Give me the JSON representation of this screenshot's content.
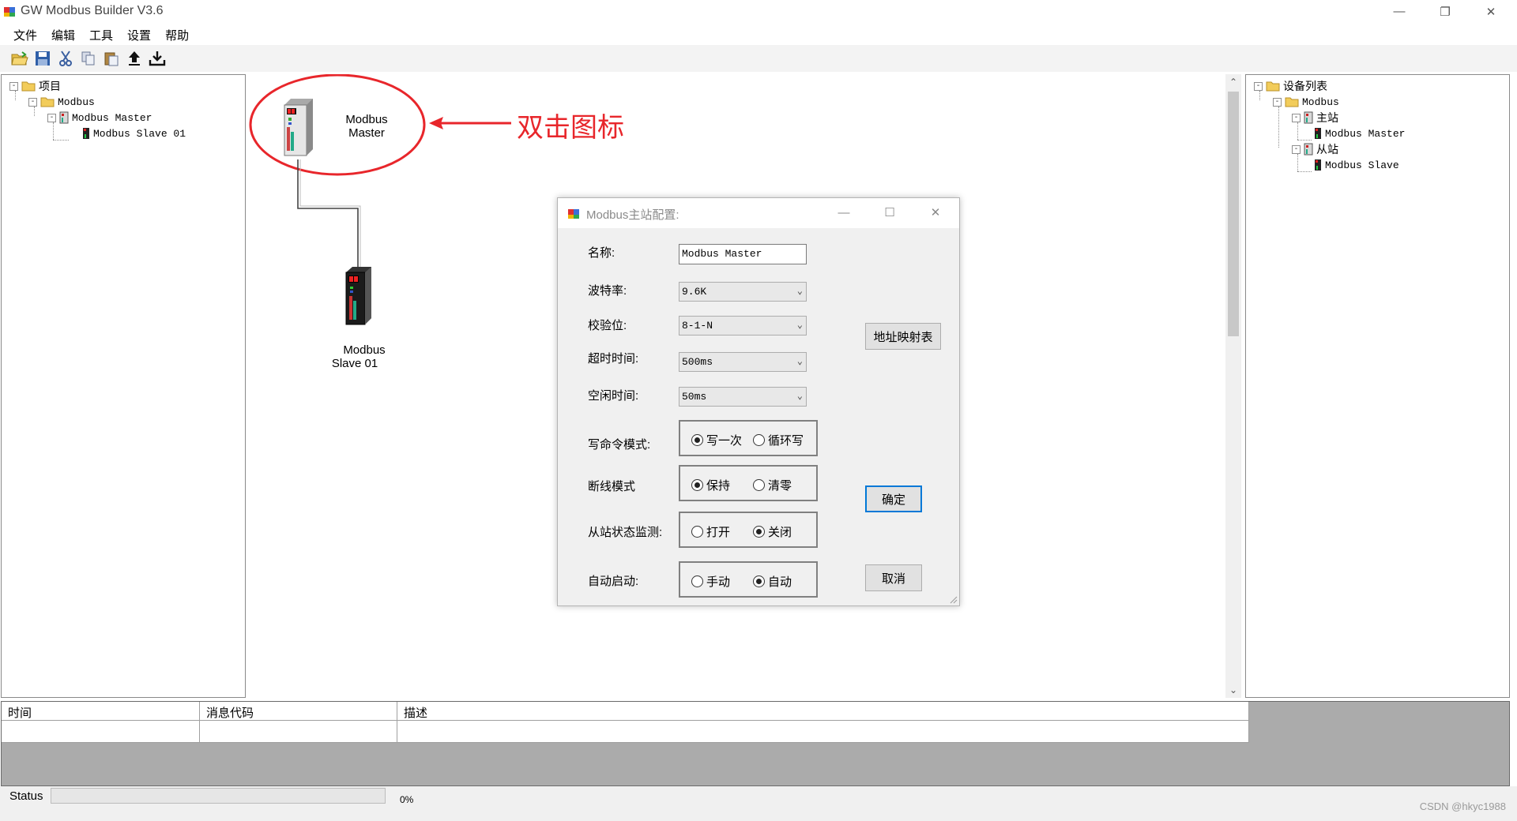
{
  "window": {
    "title": "GW Modbus Builder V3.6"
  },
  "menu": [
    "文件",
    "编辑",
    "工具",
    "设置",
    "帮助"
  ],
  "toolbar": [
    "open-icon",
    "save-icon",
    "cut-icon",
    "copy-icon",
    "paste-icon",
    "upload-icon",
    "download-icon"
  ],
  "left_tree": {
    "root": "项目",
    "modbus": "Modbus",
    "master": "Modbus Master",
    "slave": "Modbus Slave  01"
  },
  "right_tree": {
    "root": "设备列表",
    "modbus": "Modbus",
    "master_group": "主站",
    "master": "Modbus Master",
    "slave_group": "从站",
    "slave": "Modbus Slave"
  },
  "canvas": {
    "master_label_line1": "Modbus",
    "master_label_line2": "Master",
    "slave_label_line1": "Modbus",
    "slave_label_line2": "Slave  01",
    "annotation": "双击图标",
    "annotation_color": "#e8262b"
  },
  "dialog": {
    "title": "Modbus主站配置:",
    "name_label": "名称:",
    "name_value": "Modbus Master",
    "baud_label": "波特率:",
    "baud_value": "9.6K",
    "parity_label": "校验位:",
    "parity_value": "8-1-N",
    "timeout_label": "超时时间:",
    "timeout_value": "500ms",
    "idle_label": "空闲时间:",
    "idle_value": "50ms",
    "write_mode_label": "写命令模式:",
    "write_mode_options": [
      "写一次",
      "循环写"
    ],
    "write_mode_selected": "写一次",
    "disconnect_label": "断线模式",
    "disconnect_options": [
      "保持",
      "清零"
    ],
    "disconnect_selected": "保持",
    "monitor_label": "从站状态监测:",
    "monitor_options": [
      "打开",
      "关闭"
    ],
    "monitor_selected": "关闭",
    "autostart_label": "自动启动:",
    "autostart_options": [
      "手动",
      "自动"
    ],
    "autostart_selected": "自动",
    "address_map_button": "地址映射表",
    "ok_button": "确定",
    "cancel_button": "取消"
  },
  "log": {
    "columns": [
      "时间",
      "消息代码",
      "描述"
    ]
  },
  "status": {
    "label": "Status",
    "progress_fraction": 0,
    "percent": "0%",
    "watermark": "CSDN @hkyc1988"
  }
}
